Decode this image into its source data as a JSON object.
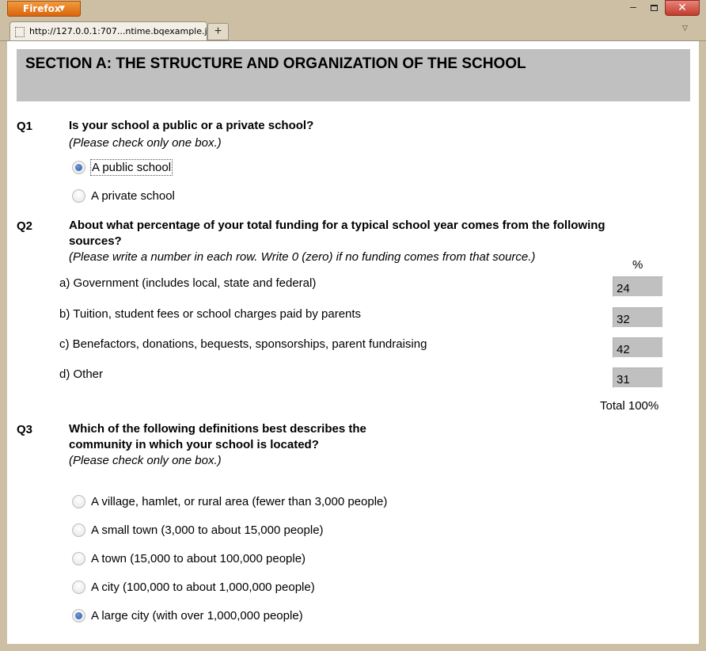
{
  "browser": {
    "menu_button": "Firefox",
    "tab_title": "http://127.0.0.1:707...ntime.bqexample.jar/",
    "new_tab": "+"
  },
  "section": {
    "title": "SECTION A: THE STRUCTURE AND ORGANIZATION OF THE SCHOOL"
  },
  "q1": {
    "number": "Q1",
    "text": "Is your school a public or a private school?",
    "instruction": "(Please check only one box.)",
    "options": [
      {
        "label": "A public school",
        "checked": true
      },
      {
        "label": "A private school",
        "checked": false
      }
    ]
  },
  "q2": {
    "number": "Q2",
    "text_line1": "About what percentage of your total funding for a typical school year comes from the following",
    "text_line2": "sources?",
    "instruction": "(Please write a number in each row. Write 0 (zero) if no funding comes from that source.)",
    "percent_header": "%",
    "rows": [
      {
        "label": "a) Government (includes local, state and federal)",
        "value": "24"
      },
      {
        "label": "b) Tuition, student fees or school charges paid by parents",
        "value": "32"
      },
      {
        "label": "c) Benefactors, donations, bequests, sponsorships, parent fundraising",
        "value": "42"
      },
      {
        "label": "d) Other",
        "value": "31"
      }
    ],
    "total_label": "Total 100%"
  },
  "q3": {
    "number": "Q3",
    "text_line1": "Which of the following definitions best describes the",
    "text_line2": "community in which your school is located?",
    "instruction": "(Please check only one box.)",
    "options": [
      {
        "label": "A village, hamlet, or rural area (fewer than 3,000 people)",
        "checked": false
      },
      {
        "label": "A small town (3,000 to about 15,000 people)",
        "checked": false
      },
      {
        "label": "A town (15,000 to about 100,000 people)",
        "checked": false
      },
      {
        "label": "A city (100,000 to about 1,000,000 people)",
        "checked": false
      },
      {
        "label": "A large city (with over 1,000,000 people)",
        "checked": true
      }
    ]
  }
}
